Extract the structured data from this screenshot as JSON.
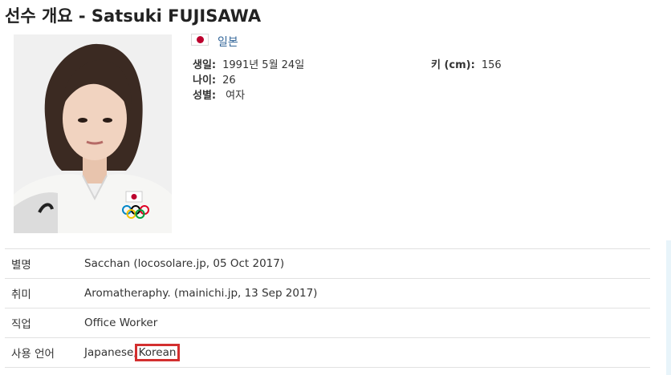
{
  "page": {
    "title": "선수 개요 - Satsuki FUJISAWA"
  },
  "profile": {
    "country": "일본",
    "birth_label": "생일:",
    "birth_value": "1991년 5월 24일",
    "age_label": "나이:",
    "age_value": "26",
    "gender_label": "성별:",
    "gender_value": "여자",
    "height_label": "키 (cm):",
    "height_value": "156"
  },
  "bio": {
    "rows": [
      {
        "label": "별명",
        "value": "Sacchan (locosolare.jp, 05 Oct 2017)"
      },
      {
        "label": "취미",
        "value": "Aromatheraphy. (mainichi.jp, 13 Sep 2017)"
      },
      {
        "label": "직업",
        "value": "Office Worker"
      },
      {
        "label": "사용 언어",
        "value_a": "Japanese,",
        "value_b": "Korean"
      }
    ]
  },
  "colors": {
    "link": "#336699",
    "highlight": "#d32f2f",
    "flag_red": "#bc002d"
  }
}
